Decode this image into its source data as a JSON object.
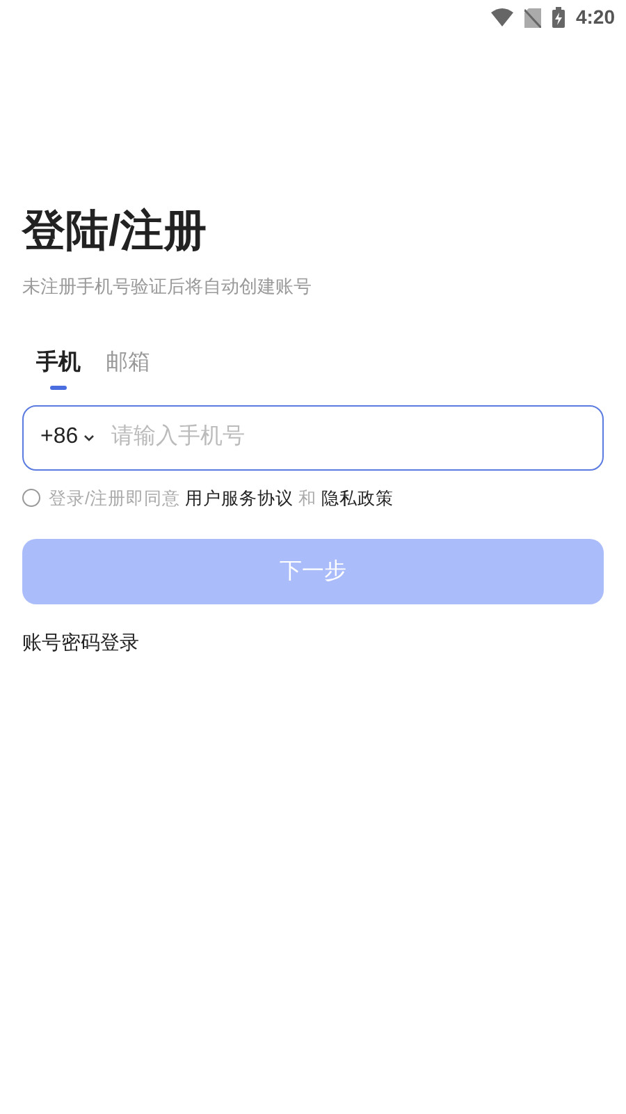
{
  "status_bar": {
    "time": "4:20"
  },
  "title": "登陆/注册",
  "subtitle": "未注册手机号验证后将自动创建账号",
  "tabs": [
    {
      "label": "手机",
      "selected": true
    },
    {
      "label": "邮箱",
      "selected": false
    }
  ],
  "phone_field": {
    "country_code": "+86",
    "placeholder": "请输入手机号"
  },
  "agreement": {
    "checked": false,
    "prefix": "登录/注册即同意",
    "terms_link": "用户服务协议",
    "conjunction": "和",
    "privacy_link": "隐私政策"
  },
  "next_button": {
    "label": "下一步",
    "disabled": true
  },
  "password_login_link": "账号密码登录"
}
